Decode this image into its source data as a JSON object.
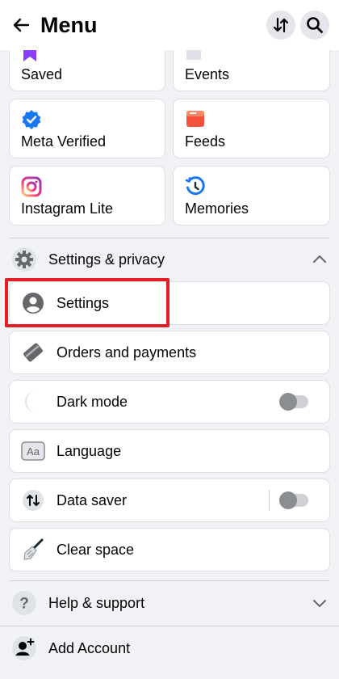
{
  "header": {
    "title": "Menu",
    "back_icon": "arrow-left-icon",
    "sort_icon": "sort-arrows-icon",
    "search_icon": "search-icon"
  },
  "shortcuts": [
    {
      "label": "Saved",
      "icon": "bookmark-icon"
    },
    {
      "label": "Events",
      "icon": "calendar-icon"
    },
    {
      "label": "Meta Verified",
      "icon": "verified-badge-icon"
    },
    {
      "label": "Feeds",
      "icon": "feeds-icon"
    },
    {
      "label": "Instagram Lite",
      "icon": "instagram-icon"
    },
    {
      "label": "Memories",
      "icon": "memories-clock-icon"
    }
  ],
  "settings_section": {
    "label": "Settings & privacy",
    "icon": "gear-icon",
    "expanded": true,
    "items": [
      {
        "label": "Settings",
        "icon": "person-circle-icon"
      },
      {
        "label": "Orders and payments",
        "icon": "card-icon"
      },
      {
        "label": "Dark mode",
        "icon": "moon-icon",
        "toggle": false
      },
      {
        "label": "Language",
        "icon": "language-aa-icon"
      },
      {
        "label": "Data saver",
        "icon": "data-arrows-icon",
        "toggle": false
      },
      {
        "label": "Clear space",
        "icon": "broom-icon"
      }
    ]
  },
  "help_section": {
    "label": "Help & support",
    "icon": "question-icon",
    "expanded": false
  },
  "add_account": {
    "label": "Add Account",
    "icon": "add-account-icon"
  },
  "colors": {
    "accent": "#1877f2",
    "highlight": "#e41e26",
    "background": "#f0f2f5"
  }
}
